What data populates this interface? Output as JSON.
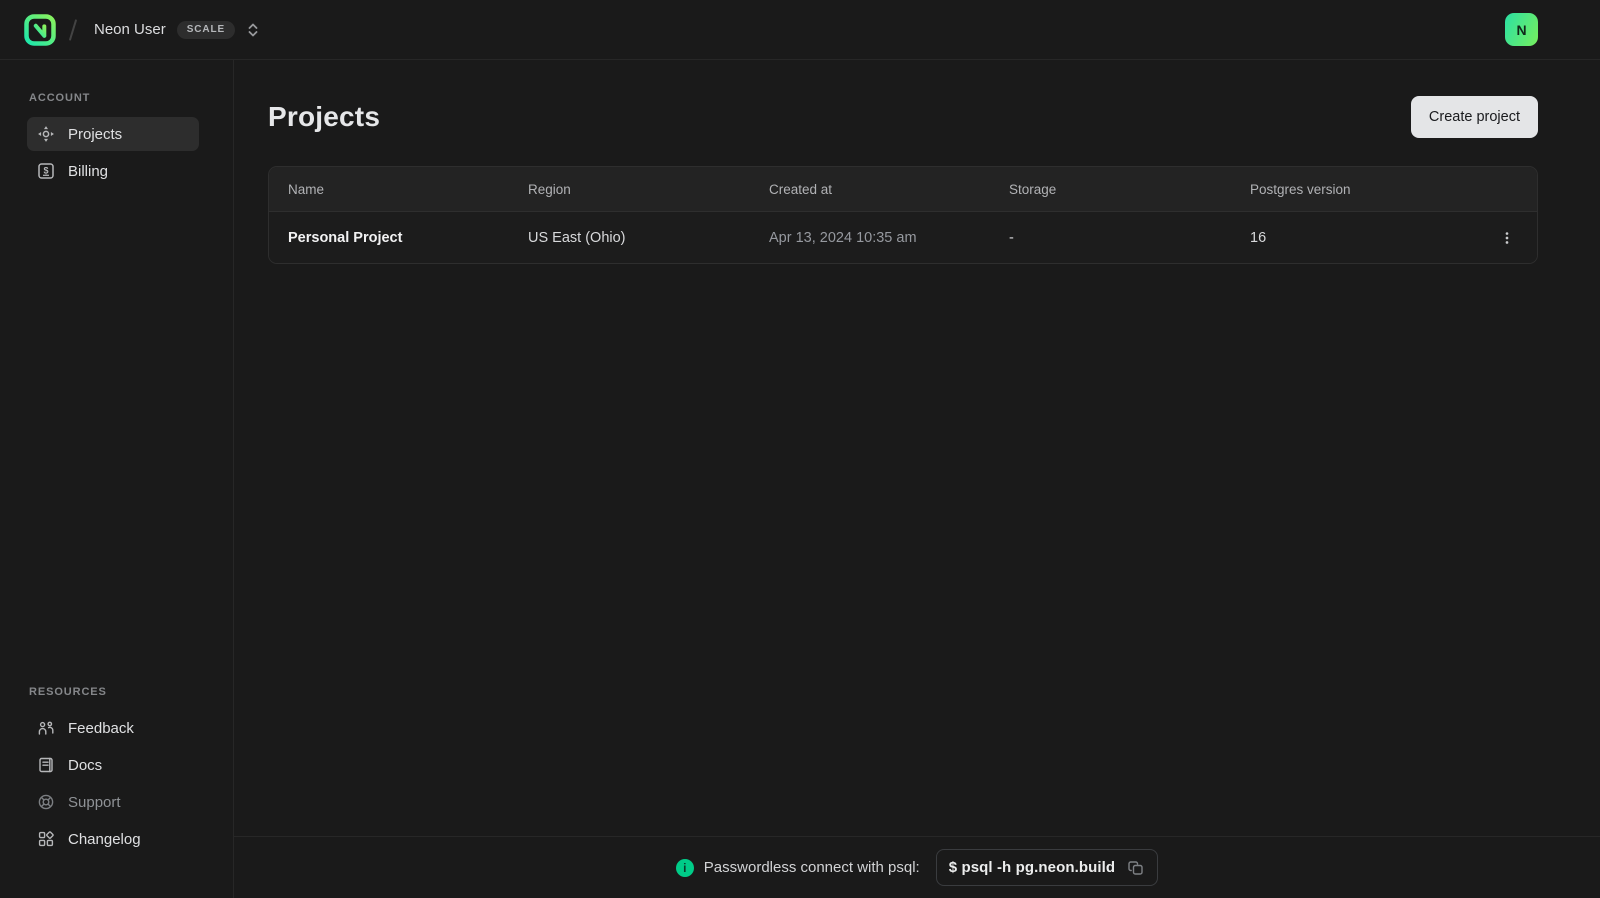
{
  "colors": {
    "accent_green": "#00e599",
    "surface": "#1a1a1a",
    "table_header": "#232323"
  },
  "topbar": {
    "user": "Neon User",
    "plan": "SCALE",
    "avatar": "N"
  },
  "sidebar": {
    "sections": {
      "account": "ACCOUNT",
      "resources": "RESOURCES"
    },
    "account_items": [
      {
        "label": "Projects",
        "icon": "projects-icon",
        "active": true
      },
      {
        "label": "Billing",
        "icon": "billing-icon",
        "active": false
      }
    ],
    "resource_items": [
      {
        "label": "Feedback",
        "icon": "feedback-icon"
      },
      {
        "label": "Docs",
        "icon": "docs-icon"
      },
      {
        "label": "Support",
        "icon": "support-icon",
        "muted": true
      },
      {
        "label": "Changelog",
        "icon": "changelog-icon"
      }
    ]
  },
  "main": {
    "title": "Projects",
    "create_button": "Create project",
    "table": {
      "columns": [
        "Name",
        "Region",
        "Created at",
        "Storage",
        "Postgres version"
      ],
      "rows": [
        {
          "name": "Personal Project",
          "region": "US East (Ohio)",
          "created_at": "Apr 13, 2024 10:35 am",
          "storage": "-",
          "postgres_version": "16"
        }
      ]
    }
  },
  "footer": {
    "info": "i",
    "label": "Passwordless connect with psql:",
    "command": "$ psql -h pg.neon.build"
  }
}
